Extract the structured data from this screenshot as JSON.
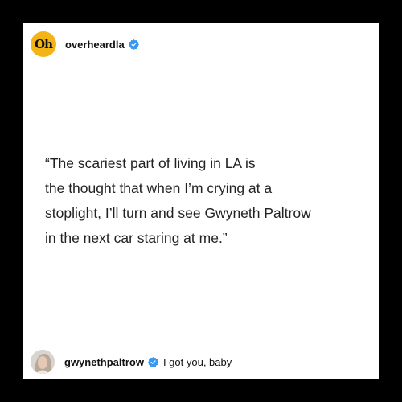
{
  "post": {
    "account": {
      "avatar_icon": "overheardla-logo",
      "logo_text": "Oh",
      "logo_color": "#f3b417",
      "handle": "overheardla",
      "verified_icon": "verified-badge-icon"
    },
    "quote": "“The scariest part of living in LA is\nthe thought that when I’m crying at a\nstoplight, I’ll turn and see Gwyneth Paltrow\nin the next car staring at me.”",
    "reply": {
      "avatar_icon": "user-avatar",
      "handle": "gwynethpaltrow",
      "verified_icon": "verified-badge-icon",
      "text": "I got you, baby"
    }
  },
  "colors": {
    "background": "#000000",
    "card": "#ffffff",
    "verified_blue": "#3897f0"
  }
}
